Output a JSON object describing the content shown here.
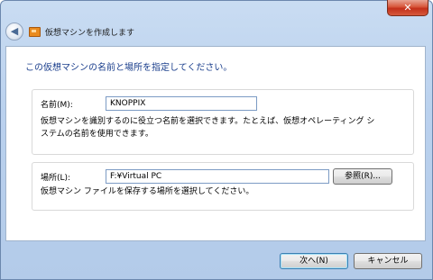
{
  "window": {
    "title": "仮想マシンを作成します",
    "close_glyph": "✕"
  },
  "heading": "この仮想マシンの名前と場所を指定してください。",
  "name_section": {
    "label": "名前(M):",
    "value": "KNOPPIX",
    "description_line1": "仮想マシンを識別するのに役立つ名前を選択できます。たとえば、仮想オペレーティング シ",
    "description_line2": "ステムの名前を使用できます。"
  },
  "location_section": {
    "label": "場所(L):",
    "value": "F:¥Virtual PC",
    "browse_label": "参照(R)...",
    "description": "仮想マシン ファイルを保存する場所を選択してください。"
  },
  "footer": {
    "next_label": "次へ(N)",
    "cancel_label": "キャンセル"
  },
  "icons": {
    "back": "back-arrow-icon",
    "app": "virtual-pc-icon",
    "close": "close-icon"
  }
}
